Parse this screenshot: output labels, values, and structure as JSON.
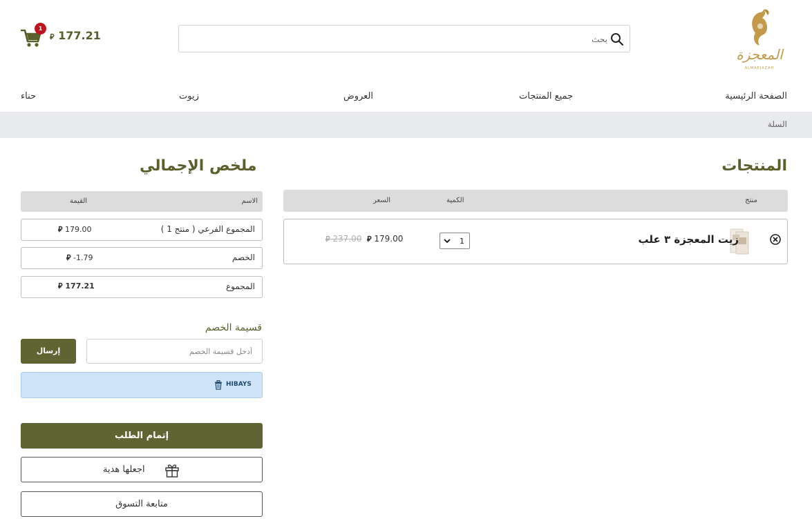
{
  "header": {
    "logo_text": "المعجزة",
    "logo_sub": "ALMAEJAZAH",
    "search_placeholder": "بحث",
    "cart_count": "1",
    "cart_total": "177.21"
  },
  "currency_symbol": "⃁",
  "nav": {
    "items": [
      "الصفحة الرئيسية",
      "جميع المنتجات",
      "العروض",
      "زيوت",
      "حناء"
    ]
  },
  "breadcrumb": "السلة",
  "products": {
    "title": "المنتجات",
    "columns": {
      "product": "منتج",
      "quantity": "الكمية",
      "price": "السعر"
    },
    "items": [
      {
        "name": "زيت المعجزة ٣ علب",
        "quantity": "1",
        "price": "179.00",
        "old_price": "237.00"
      }
    ]
  },
  "summary": {
    "title": "ملخص الإجمالي",
    "columns": {
      "name": "الاسم",
      "value": "القيمة"
    },
    "rows": [
      {
        "label": "المجموع الفرعي ( منتج 1 )",
        "value": "179.00"
      },
      {
        "label": "الخصم",
        "value": "-1.79"
      },
      {
        "label": "المجموع",
        "value": "177.21"
      }
    ]
  },
  "coupon": {
    "label": "قسيمة الخصم",
    "placeholder": "أدخل قسيمة الخصم",
    "submit_label": "إرسال",
    "applied_code": "HIBAYS"
  },
  "actions": {
    "checkout_label": "إتمام الطلب",
    "gift_label": "اجعلها هدية",
    "continue_label": "متابعة التسوق"
  },
  "colors": {
    "brand_olive": "#5f6432",
    "brand_gold": "#c29a4a",
    "badge_red": "#c0151f",
    "coupon_bg": "#cfe4f9"
  }
}
